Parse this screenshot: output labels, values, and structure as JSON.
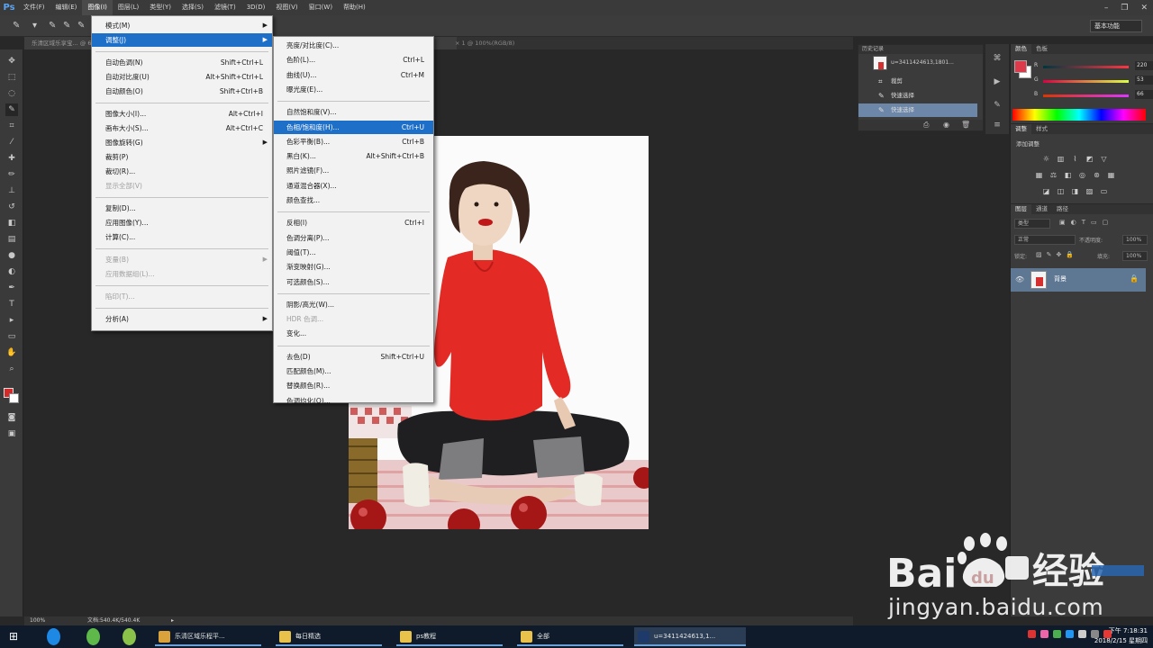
{
  "app": {
    "logo": "Ps"
  },
  "menubar": {
    "items": [
      "文件(F)",
      "编辑(E)",
      "图像(I)",
      "图层(L)",
      "类型(Y)",
      "选择(S)",
      "滤镜(T)",
      "3D(D)",
      "视图(V)",
      "窗口(W)",
      "帮助(H)"
    ],
    "active_index": 2
  },
  "window_controls": {
    "minimize": "–",
    "restore": "❐",
    "close": "✕"
  },
  "optionsbar": {
    "workspace": "基本功能"
  },
  "document": {
    "tab": "乐清区域乐享宝... @ 66.7% (图层 1, RGB/8) *",
    "tab_suffix": "× 1 @ 100%(RGB/8)"
  },
  "image_menu": {
    "items": [
      {
        "label": "模式(M)",
        "shortcut": "",
        "submenu": true,
        "disabled": false
      },
      {
        "label": "调整(J)",
        "shortcut": "",
        "submenu": true,
        "disabled": false,
        "highlighted": true
      },
      {
        "label": "自动色调(N)",
        "shortcut": "Shift+Ctrl+L",
        "submenu": false,
        "disabled": false
      },
      {
        "label": "自动对比度(U)",
        "shortcut": "Alt+Shift+Ctrl+L",
        "submenu": false,
        "disabled": false
      },
      {
        "label": "自动颜色(O)",
        "shortcut": "Shift+Ctrl+B",
        "submenu": false,
        "disabled": false
      },
      {
        "label": "图像大小(I)...",
        "shortcut": "Alt+Ctrl+I",
        "submenu": false,
        "disabled": false
      },
      {
        "label": "画布大小(S)...",
        "shortcut": "Alt+Ctrl+C",
        "submenu": false,
        "disabled": false
      },
      {
        "label": "图像旋转(G)",
        "shortcut": "",
        "submenu": true,
        "disabled": false
      },
      {
        "label": "裁剪(P)",
        "shortcut": "",
        "submenu": false,
        "disabled": false
      },
      {
        "label": "裁切(R)...",
        "shortcut": "",
        "submenu": false,
        "disabled": false
      },
      {
        "label": "显示全部(V)",
        "shortcut": "",
        "submenu": false,
        "disabled": true
      },
      {
        "label": "复制(D)...",
        "shortcut": "",
        "submenu": false,
        "disabled": false
      },
      {
        "label": "应用图像(Y)...",
        "shortcut": "",
        "submenu": false,
        "disabled": false
      },
      {
        "label": "计算(C)...",
        "shortcut": "",
        "submenu": false,
        "disabled": false
      },
      {
        "label": "变量(B)",
        "shortcut": "",
        "submenu": true,
        "disabled": true
      },
      {
        "label": "应用数据组(L)...",
        "shortcut": "",
        "submenu": false,
        "disabled": true
      },
      {
        "label": "陷印(T)...",
        "shortcut": "",
        "submenu": false,
        "disabled": true
      },
      {
        "label": "分析(A)",
        "shortcut": "",
        "submenu": true,
        "disabled": false
      }
    ]
  },
  "adjust_menu": {
    "items": [
      {
        "label": "亮度/对比度(C)...",
        "shortcut": ""
      },
      {
        "label": "色阶(L)...",
        "shortcut": "Ctrl+L"
      },
      {
        "label": "曲线(U)...",
        "shortcut": "Ctrl+M"
      },
      {
        "label": "曝光度(E)...",
        "shortcut": ""
      },
      {
        "label": "自然饱和度(V)...",
        "shortcut": ""
      },
      {
        "label": "色相/饱和度(H)...",
        "shortcut": "Ctrl+U",
        "highlighted": true
      },
      {
        "label": "色彩平衡(B)...",
        "shortcut": "Ctrl+B"
      },
      {
        "label": "黑白(K)...",
        "shortcut": "Alt+Shift+Ctrl+B"
      },
      {
        "label": "照片滤镜(F)...",
        "shortcut": ""
      },
      {
        "label": "通道混合器(X)...",
        "shortcut": ""
      },
      {
        "label": "颜色查找...",
        "shortcut": ""
      },
      {
        "label": "反相(I)",
        "shortcut": "Ctrl+I"
      },
      {
        "label": "色调分离(P)...",
        "shortcut": ""
      },
      {
        "label": "阈值(T)...",
        "shortcut": ""
      },
      {
        "label": "渐变映射(G)...",
        "shortcut": ""
      },
      {
        "label": "可选颜色(S)...",
        "shortcut": ""
      },
      {
        "label": "阴影/高光(W)...",
        "shortcut": ""
      },
      {
        "label": "HDR 色调...",
        "shortcut": "",
        "disabled": true
      },
      {
        "label": "变化...",
        "shortcut": ""
      },
      {
        "label": "去色(D)",
        "shortcut": "Shift+Ctrl+U"
      },
      {
        "label": "匹配颜色(M)...",
        "shortcut": ""
      },
      {
        "label": "替换颜色(R)...",
        "shortcut": ""
      },
      {
        "label": "色调均化(Q)...",
        "shortcut": ""
      }
    ]
  },
  "history": {
    "tab": "历史记录",
    "snapshot": "u=3411424613,1801...",
    "rows": [
      "裁剪",
      "快速选择",
      "快速选择"
    ],
    "selected_index": 2
  },
  "color_panel": {
    "tabs": [
      "颜色",
      "色板"
    ],
    "channels": [
      {
        "label": "R",
        "value": "220"
      },
      {
        "label": "G",
        "value": "53"
      },
      {
        "label": "B",
        "value": "66"
      }
    ],
    "front_color": "#dc3a4a"
  },
  "adjust_panel": {
    "tabs": [
      "调整",
      "样式"
    ],
    "title": "添加调整"
  },
  "layers_panel": {
    "tabs": [
      "图层",
      "通道",
      "路径"
    ],
    "kind": "类型",
    "blend": "正常",
    "opacity_label": "不透明度:",
    "opacity": "100%",
    "lock_label": "锁定:",
    "fill_label": "填充:",
    "fill": "100%",
    "layer_name": "背景"
  },
  "statusbar": {
    "zoom": "100%",
    "doc": "文档:540.4K/540.4K"
  },
  "taskbar": {
    "items": [
      {
        "label": "乐清区域乐程平...",
        "color": "#d9a23a"
      },
      {
        "label": "每日精选",
        "color": "#e8c24a"
      },
      {
        "label": "ps教程",
        "color": "#e8c24a"
      },
      {
        "label": "全部",
        "color": "#e8c24a"
      },
      {
        "label": "u=3411424613,1...",
        "color": "#1e3a6a",
        "active": true
      }
    ],
    "time": "下午 7:18:31",
    "date": "2018/2/15 星期四"
  },
  "watermark": {
    "url": "jingyan.baidu.com"
  }
}
